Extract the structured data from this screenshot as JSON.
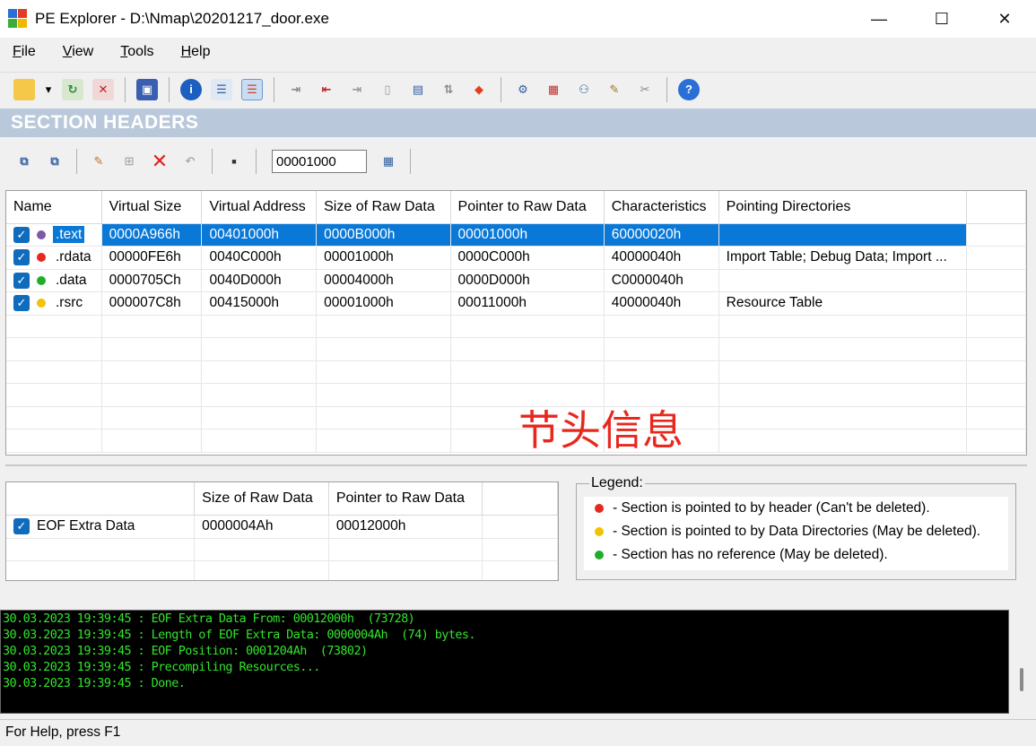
{
  "window": {
    "title": "PE Explorer - D:\\Nmap\\20201217_door.exe",
    "minimize": "—",
    "maximize": "☐",
    "close": "✕"
  },
  "menu": [
    {
      "label": "File",
      "hotkey": "F",
      "rest": "ile"
    },
    {
      "label": "View",
      "hotkey": "V",
      "rest": "iew"
    },
    {
      "label": "Tools",
      "hotkey": "T",
      "rest": "ools"
    },
    {
      "label": "Help",
      "hotkey": "H",
      "rest": "elp"
    }
  ],
  "section_title": "SECTION HEADERS",
  "offset_value": "00001000",
  "columns": [
    "Name",
    "Virtual Size",
    "Virtual Address",
    "Size of Raw Data",
    "Pointer to Raw Data",
    "Characteristics",
    "Pointing Directories"
  ],
  "rows": [
    {
      "name": ".text",
      "dot": "#7c5aa6",
      "vsize": "0000A966h",
      "vaddr": "00401000h",
      "rawsize": "0000B000h",
      "rawptr": "00001000h",
      "chars": "60000020h",
      "dirs": ""
    },
    {
      "name": ".rdata",
      "dot": "#e42a1f",
      "vsize": "00000FE6h",
      "vaddr": "0040C000h",
      "rawsize": "00001000h",
      "rawptr": "0000C000h",
      "chars": "40000040h",
      "dirs": "Import Table; Debug Data; Import ..."
    },
    {
      "name": ".data",
      "dot": "#1fae28",
      "vsize": "0000705Ch",
      "vaddr": "0040D000h",
      "rawsize": "00004000h",
      "rawptr": "0000D000h",
      "chars": "C0000040h",
      "dirs": ""
    },
    {
      "name": ".rsrc",
      "dot": "#f2c300",
      "vsize": "000007C8h",
      "vaddr": "00415000h",
      "rawsize": "00001000h",
      "rawptr": "00011000h",
      "chars": "40000040h",
      "dirs": "Resource Table"
    }
  ],
  "annotation": "节头信息",
  "eof": {
    "columns": [
      "",
      "Size of Raw Data",
      "Pointer to Raw Data"
    ],
    "name": "EOF Extra Data",
    "rawsize": "0000004Ah",
    "rawptr": "00012000h"
  },
  "legend": {
    "title": "Legend:",
    "items": [
      {
        "color": "#e42a1f",
        "text": "- Section is pointed to by header (Can't be deleted)."
      },
      {
        "color": "#f2c300",
        "text": "- Section is pointed to by Data Directories (May be deleted)."
      },
      {
        "color": "#1fae28",
        "text": "- Section has no reference (May be deleted)."
      }
    ]
  },
  "log": [
    "30.03.2023 19:39:45 : EOF Extra Data From: 00012000h  (73728)",
    "30.03.2023 19:39:45 : Length of EOF Extra Data: 0000004Ah  (74) bytes.",
    "30.03.2023 19:39:45 : EOF Position: 0001204Ah  (73802)",
    "30.03.2023 19:39:45 : Precompiling Resources...",
    "30.03.2023 19:39:45 : Done."
  ],
  "status": "For Help, press F1"
}
